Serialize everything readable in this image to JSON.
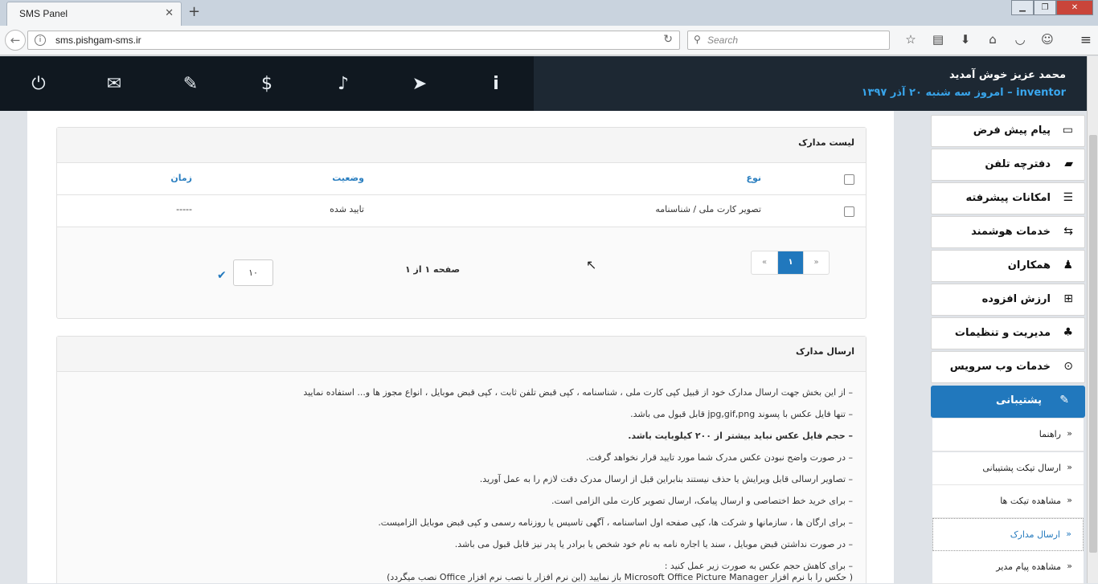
{
  "browser": {
    "tab_title": "SMS Panel",
    "tab_close": "✕",
    "new_tab": "+",
    "url": "sms.pishgam-sms.ir",
    "search_placeholder": "Search",
    "window_buttons": [
      "▁",
      "❐",
      "✕"
    ]
  },
  "header": {
    "icons": [
      "power-icon",
      "envelope-icon",
      "ticket-icon",
      "dollar-icon",
      "bell-icon",
      "send-icon",
      "info-icon"
    ],
    "welcome": "محمد عزیز خوش آمدید",
    "username": "inventor",
    "date_line": " – امروز سه شنبه ۲۰ آذر ۱۳۹۷"
  },
  "documents": {
    "title": "لیست مدارک",
    "columns": [
      "نوع",
      "وضعیت",
      "زمان"
    ],
    "rows": [
      {
        "type": "تصویر کارت ملی / شناسنامه",
        "status": "تایید شده",
        "time": "-----"
      }
    ],
    "pager": {
      "prev": "«",
      "current": "۱",
      "next": "»"
    },
    "page_info": "صفحه ۱ از ۱",
    "per_page": "۱۰"
  },
  "send_documents": {
    "title": "ارسال مدارک",
    "notes": [
      "– از این بخش جهت ارسال مدارک خود از قبیل کپی کارت ملی ، شناسنامه ، کپی قبض تلفن ثابت ، کپی قبض موبایل ، انواع مجوز ها و... استفاده نمایید",
      "– تنها فایل عکس با پسوند jpg,gif,png قابل قبول می باشد.",
      "– حجم فایل عکس نباید بیشتر از ۲۰۰ کیلوبایت باشد.",
      "– در صورت واضح نبودن عکس مدرک شما مورد تایید قرار نخواهد گرفت.",
      "– تصاویر ارسالی قابل ویرایش یا حذف نیستند بنابراین قبل از ارسال مدرک دقت لازم را به عمل آورید.",
      "– برای خرید خط اختصاصی و ارسال پیامک، ارسال تصویر کارت ملی الزامی است.",
      "– برای ارگان ها ، سازمانها و شرکت ها، کپی صفحه اول اساسنامه ، آگهی تاسیس یا روزنامه رسمی و کپی قبض موبایل الزامیست.",
      "– در صورت نداشتن قبض موبایل ، سند یا اجاره نامه به نام خود شخص یا برادر یا پدر نیز قابل قبول می باشد.",
      "– برای کاهش حجم عکس به صورت زیر عمل کنید :",
      "( حکس را با نرم افزار Microsoft Office Picture Manager باز نمایید (این نرم افزار با نصب نرم افزار Office نصب میگردد)"
    ]
  },
  "sidebar": {
    "items": [
      {
        "label": "پیام پیش فرض",
        "icon": "▭"
      },
      {
        "label": "دفترچه تلفن",
        "icon": "▰"
      },
      {
        "label": "امکانات پیشرفته",
        "icon": "☰"
      },
      {
        "label": "خدمات هوشمند",
        "icon": "⇆"
      },
      {
        "label": "همکاران",
        "icon": "♟"
      },
      {
        "label": "ارزش افزوده",
        "icon": "⊞"
      },
      {
        "label": "مدیریت و تنظیمات",
        "icon": "♣"
      },
      {
        "label": "خدمات وب سرویس",
        "icon": "⊙"
      }
    ],
    "active": {
      "label": "پشتیبانی",
      "icon": "✎"
    },
    "subitems": [
      {
        "label": "راهنما",
        "arrow": "»"
      },
      {
        "label": "ارسال تیکت پشتیبانی",
        "arrow": "»"
      },
      {
        "label": "مشاهده تیکت ها",
        "arrow": "»"
      },
      {
        "label": "ارسال مدارک",
        "arrow": "»"
      },
      {
        "label": "مشاهده پیام مدیر",
        "arrow": "»"
      }
    ]
  }
}
